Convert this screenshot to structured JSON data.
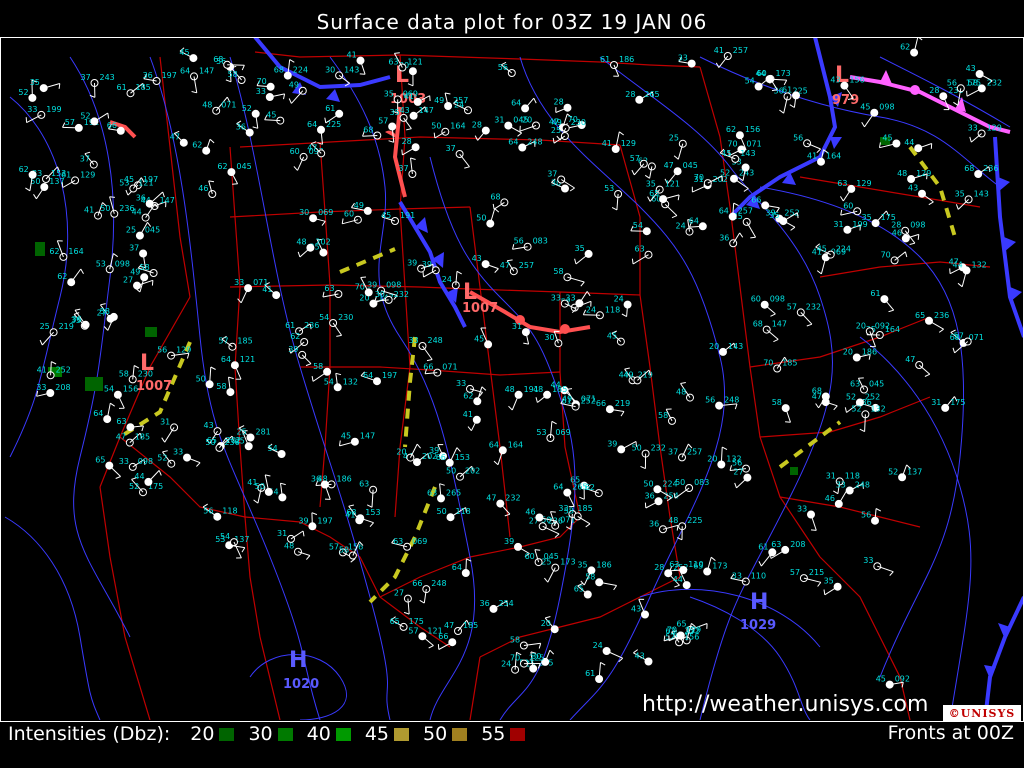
{
  "title": "Surface data plot for 03Z 19 JAN 06",
  "legend": {
    "label": "Intensities (Dbz):",
    "items": [
      {
        "value": "20",
        "color": "#006400"
      },
      {
        "value": "30",
        "color": "#007a00"
      },
      {
        "value": "40",
        "color": "#009a00"
      },
      {
        "value": "45",
        "color": "#b09a30"
      },
      {
        "value": "50",
        "color": "#a08020"
      },
      {
        "value": "55",
        "color": "#a00000"
      }
    ]
  },
  "fronts_label": "Fronts at 00Z",
  "url": "http://weather.unisys.com",
  "logo_text": "©UNISYS",
  "pressure_centers": [
    {
      "type": "L",
      "pressure": "1003"
    },
    {
      "type": "L",
      "pressure": "979"
    },
    {
      "type": "L",
      "pressure": "1007"
    },
    {
      "type": "L",
      "pressure": "1007"
    },
    {
      "type": "H",
      "pressure": "1020"
    },
    {
      "type": "H",
      "pressure": "1029"
    }
  ],
  "colors": {
    "background": "#000000",
    "isobar": "#3a3aff",
    "state_border": "#c00000",
    "station_text": "#00e0e0",
    "cold_front": "#3a3aff",
    "warm_front": "#ff5050",
    "occluded_front": "#ff60ff",
    "trough": "#c8c820"
  },
  "station_values": [
    "39",
    "43",
    "45",
    "52",
    "30",
    "37",
    "41",
    "47",
    "20",
    "24",
    "25",
    "28",
    "35",
    "61",
    "33",
    "49",
    "46",
    "50",
    "54",
    "56",
    "58",
    "63",
    "65",
    "68",
    "70",
    "27",
    "31",
    "36",
    "44",
    "48",
    "53",
    "57",
    "60",
    "62",
    "64",
    "66"
  ],
  "pressure_codes": [
    "110",
    "083",
    "045",
    "071",
    "202",
    "185",
    "132",
    "224",
    "156",
    "230",
    "098",
    "129",
    "164",
    "208",
    "254",
    "191",
    "143",
    "281",
    "257",
    "215",
    "173",
    "236",
    "197",
    "225",
    "186",
    "243",
    "121",
    "252",
    "147",
    "118",
    "265",
    "232",
    "219",
    "199",
    "175",
    "153",
    "137",
    "248",
    "069",
    "092"
  ]
}
